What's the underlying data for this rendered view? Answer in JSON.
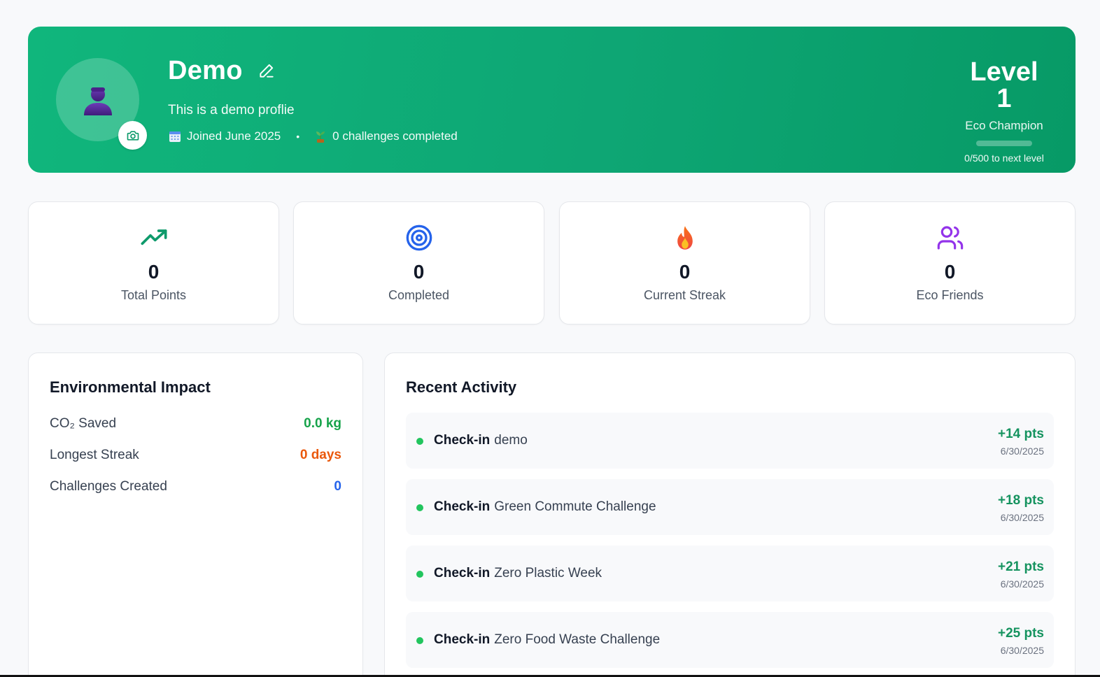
{
  "profile": {
    "name": "Demo",
    "bio": "This is a demo proflie",
    "joined": "Joined June 2025",
    "separator": "•",
    "challenges_completed": "0 challenges completed"
  },
  "level": {
    "title": "Level 1",
    "rank": "Eco Champion",
    "progress_text": "0/500 to next level",
    "progress_fraction": 0
  },
  "stats": [
    {
      "icon": "trending-up-icon",
      "value": "0",
      "label": "Total Points",
      "color": "#0e9a6b"
    },
    {
      "icon": "target-icon",
      "value": "0",
      "label": "Completed",
      "color": "#2563eb"
    },
    {
      "icon": "fire-icon",
      "value": "0",
      "label": "Current Streak",
      "color": "#f97316"
    },
    {
      "icon": "users-icon",
      "value": "0",
      "label": "Eco Friends",
      "color": "#9333ea"
    }
  ],
  "impact": {
    "title": "Environmental Impact",
    "rows": [
      {
        "label": "CO₂ Saved",
        "value": "0.0 kg",
        "color": "#16a34a"
      },
      {
        "label": "Longest Streak",
        "value": "0 days",
        "color": "#ea580c"
      },
      {
        "label": "Challenges Created",
        "value": "0",
        "color": "#2563eb"
      }
    ]
  },
  "activity": {
    "title": "Recent Activity",
    "items": [
      {
        "type": "Check-in",
        "name": "demo",
        "points": "+14 pts",
        "date": "6/30/2025"
      },
      {
        "type": "Check-in",
        "name": "Green Commute Challenge",
        "points": "+18 pts",
        "date": "6/30/2025"
      },
      {
        "type": "Check-in",
        "name": "Zero Plastic Week",
        "points": "+21 pts",
        "date": "6/30/2025"
      },
      {
        "type": "Check-in",
        "name": "Zero Food Waste Challenge",
        "points": "+25 pts",
        "date": "6/30/2025"
      }
    ]
  }
}
